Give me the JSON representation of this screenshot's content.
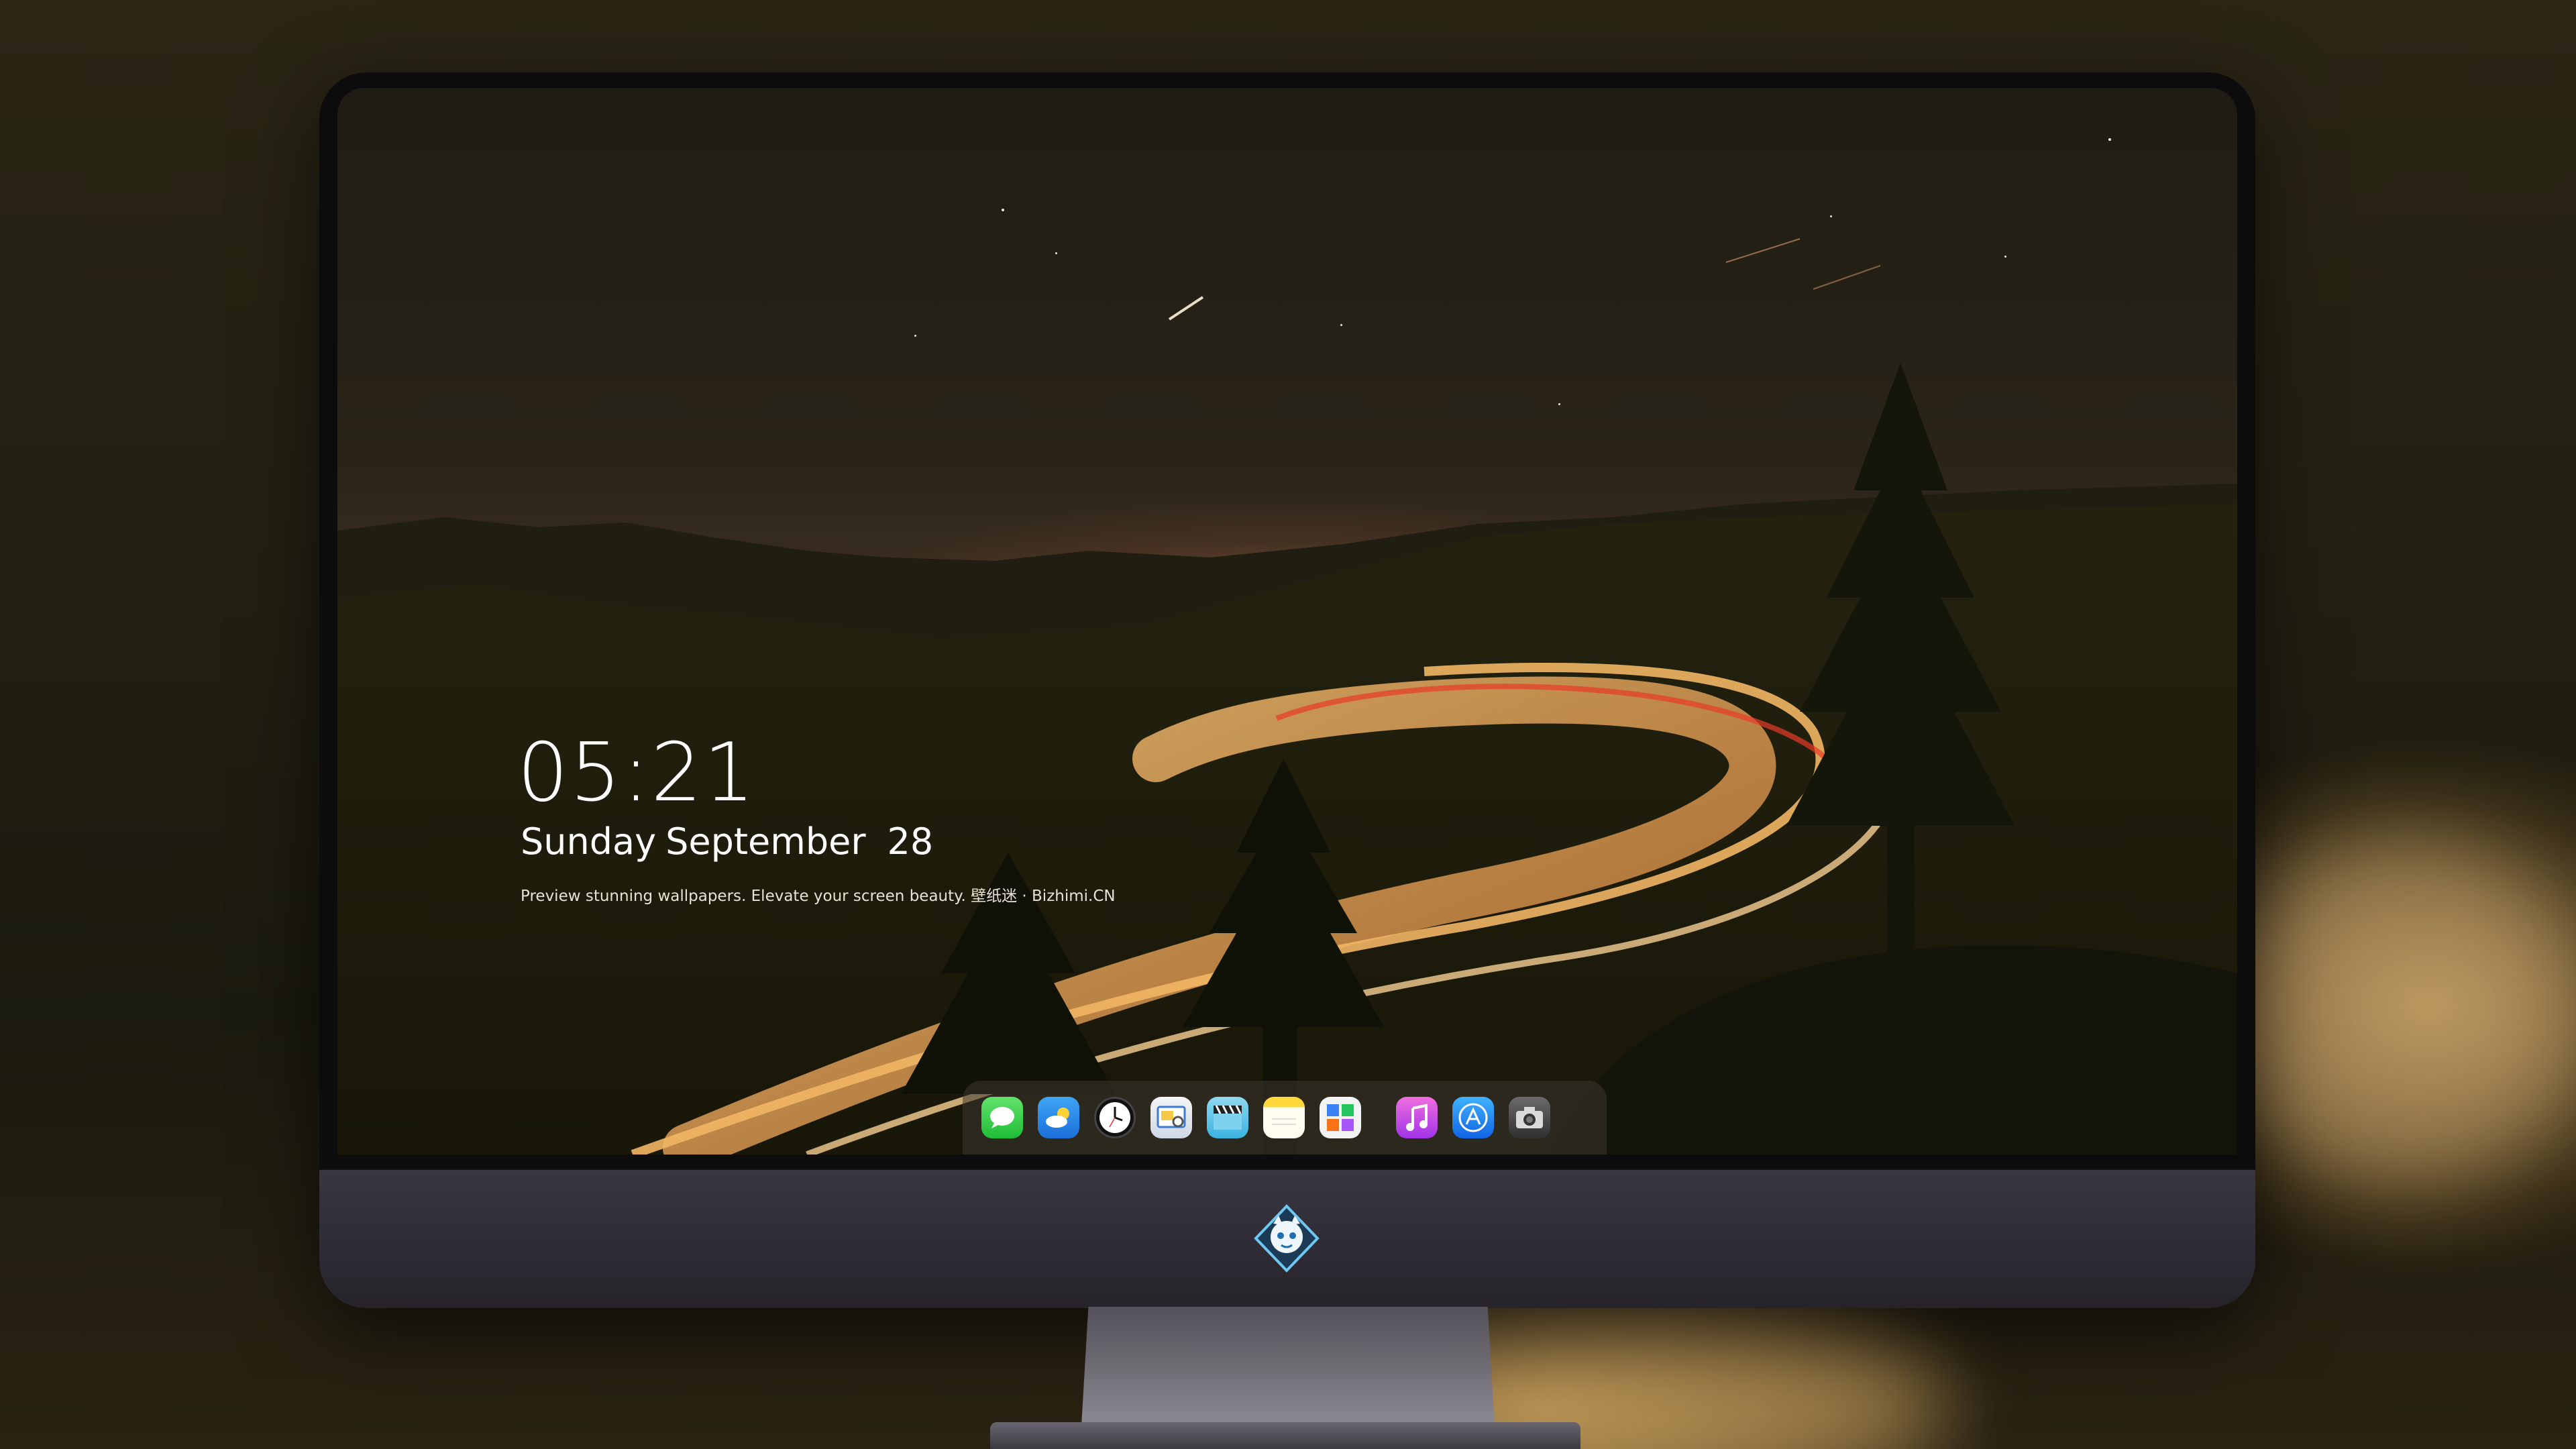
{
  "lock_screen": {
    "time": "05:21",
    "weekday": "Sunday",
    "month": "September",
    "day": "28",
    "tagline": "Preview stunning wallpapers. Elevate your screen beauty. 壁纸迷 · Bizhimi.CN"
  },
  "dock": {
    "apps": [
      {
        "name": "messages-icon",
        "color": "#2bc542"
      },
      {
        "name": "weather-icon",
        "color": "#2a86e8"
      },
      {
        "name": "clock-icon",
        "color": "#111111"
      },
      {
        "name": "preview-icon",
        "color": "#e6ecf4"
      },
      {
        "name": "clapper-icon",
        "color": "#5cc4ea"
      },
      {
        "name": "notes-icon",
        "color": "#ffd83b"
      },
      {
        "name": "photos-icon",
        "color": "#f3f3f3"
      },
      {
        "name": "music-icon",
        "color": "#c84ee4"
      },
      {
        "name": "app-store-icon",
        "color": "#1f8af2"
      },
      {
        "name": "camera-icon",
        "color": "#4a4a4a"
      }
    ]
  },
  "colors": {
    "clock_text": "#ffffff",
    "monitor_chin": "#2e2b35",
    "road_light": "#f0b060"
  }
}
